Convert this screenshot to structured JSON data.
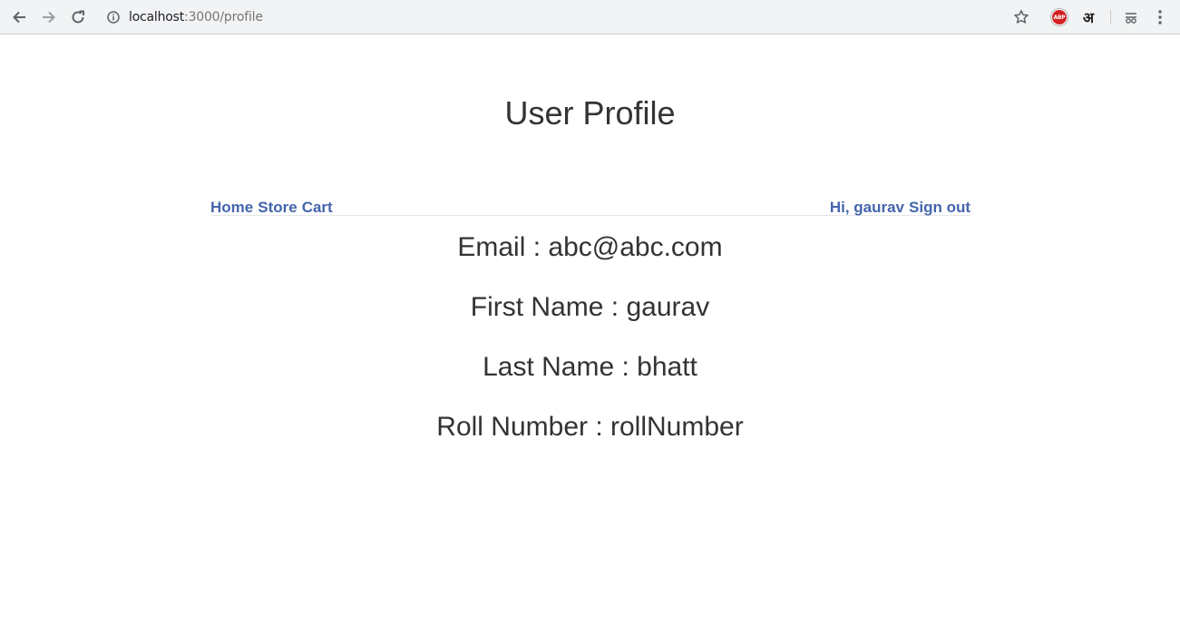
{
  "browser": {
    "url_host": "localhost",
    "url_path": ":3000/profile",
    "abp_label": "ABP",
    "translate_label": "अ"
  },
  "page": {
    "title": "User Profile"
  },
  "navbar": {
    "links": [
      "Home",
      "Store",
      "Cart"
    ],
    "greeting": "Hi, gaurav",
    "signout": "Sign out",
    "link_color": "#4565ad"
  },
  "profile": {
    "email": "Email : abc@abc.com",
    "first_name": "First Name : gaurav",
    "last_name": "Last Name : bhatt",
    "roll_number": "Roll Number : rollNumber"
  }
}
